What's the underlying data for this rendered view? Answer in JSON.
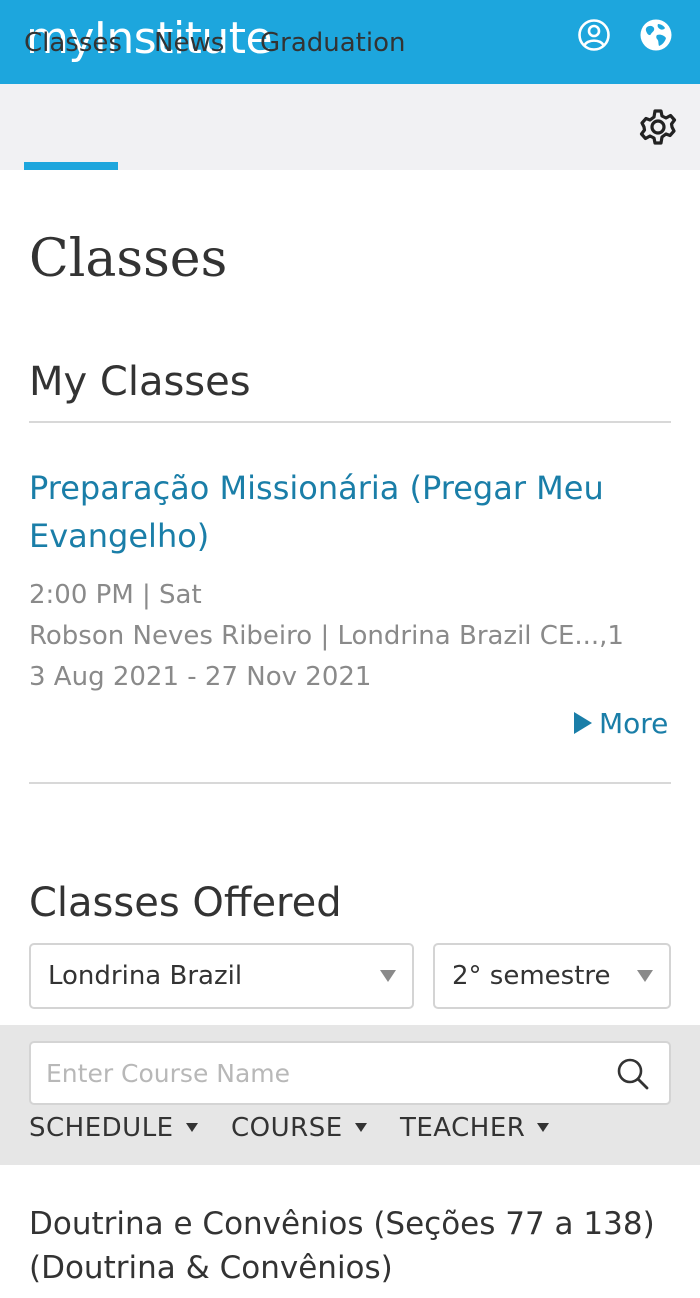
{
  "app": {
    "title": "myInstitute"
  },
  "header": {
    "icons": {
      "account": "user-circle-icon",
      "language": "globe-icon"
    }
  },
  "nav": {
    "tabs": [
      {
        "label": "Classes",
        "active": true
      },
      {
        "label": "News",
        "active": false
      },
      {
        "label": "Graduation",
        "active": false
      }
    ],
    "settings_icon": "gear-icon"
  },
  "page": {
    "title": "Classes"
  },
  "my_classes": {
    "heading": "My Classes",
    "items": [
      {
        "title": "Preparação Missionária (Pregar Meu Evangelho)",
        "schedule": "2:00 PM | Sat",
        "teacher_location": "Robson Neves Ribeiro | Londrina Brazil CE...,1",
        "dates": "3 Aug 2021 - 27 Nov 2021",
        "more_label": "More"
      }
    ]
  },
  "classes_offered": {
    "heading": "Classes Offered",
    "location_select": {
      "value": "Londrina Brazil"
    },
    "term_select": {
      "value": "2° semestre"
    },
    "search": {
      "placeholder": "Enter Course Name",
      "value": ""
    },
    "filters": [
      {
        "label": "SCHEDULE"
      },
      {
        "label": "COURSE"
      },
      {
        "label": "TEACHER"
      }
    ],
    "items": [
      {
        "title": "Doutrina e Convênios (Seções 77 a 138) (Doutrina & Convênios)"
      }
    ]
  },
  "colors": {
    "brand_blue": "#1da6dd",
    "link_blue": "#1a7ea8",
    "nav_background": "#f1f1f3",
    "filter_background": "#e6e6e6",
    "muted_text": "#8a8a8a"
  }
}
